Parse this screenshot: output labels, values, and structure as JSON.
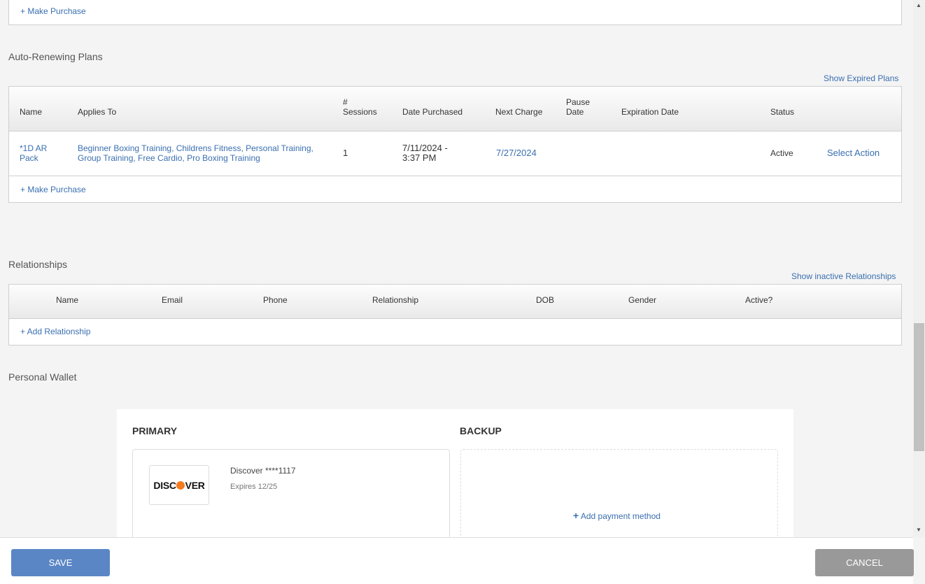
{
  "top_panel": {
    "make_purchase": "+ Make Purchase"
  },
  "auto_renewing": {
    "title": "Auto-Renewing Plans",
    "show_expired": "Show Expired Plans",
    "headers": {
      "name": "Name",
      "applies_to": "Applies To",
      "sessions_1": "#",
      "sessions_2": "Sessions",
      "date_purchased": "Date Purchased",
      "next_charge": "Next Charge",
      "pause_1": "Pause",
      "pause_2": "Date",
      "expiration": "Expiration Date",
      "status": "Status"
    },
    "row": {
      "name_1": "*1D AR",
      "name_2": "Pack",
      "applies_1": "Beginner Boxing Training, Childrens Fitness, Personal Training,",
      "applies_2": "Group Training, Free Cardio, Pro Boxing Training",
      "sessions": "1",
      "date_1": "7/11/2024 -",
      "date_2": "3:37 PM",
      "next_charge": "7/27/2024",
      "status": "Active",
      "action": "Select Action"
    },
    "make_purchase": "+ Make Purchase"
  },
  "relationships": {
    "title": "Relationships",
    "show_inactive": "Show inactive Relationships",
    "headers": {
      "name": "Name",
      "email": "Email",
      "phone": "Phone",
      "relationship": "Relationship",
      "dob": "DOB",
      "gender": "Gender",
      "active": "Active?"
    },
    "add": "+ Add Relationship"
  },
  "wallet": {
    "title": "Personal Wallet",
    "primary": "PRIMARY",
    "backup": "BACKUP",
    "card_brand": "DISCOVER",
    "card_name": "Discover ****1117",
    "card_expires": "Expires 12/25",
    "add_payment": "Add payment method"
  },
  "footer": {
    "save": "SAVE",
    "cancel": "CANCEL"
  },
  "colors": {
    "link": "#3a6fb0",
    "save": "#5b86c5",
    "cancel": "#999999",
    "discover_orange": "#f47b20"
  }
}
